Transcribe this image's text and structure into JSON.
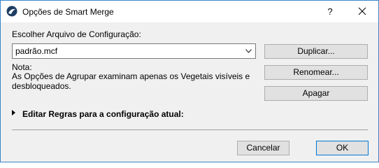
{
  "window": {
    "title": "Opções de Smart Merge",
    "help_label": "?"
  },
  "config": {
    "label": "Escolher Arquivo de Configuração:",
    "selected_file": "padrão.mcf"
  },
  "note": {
    "label": "Nota:",
    "text": "As Opções de Agrupar examinam apenas os Vegetais visíveis e desbloqueados."
  },
  "actions": {
    "duplicate": "Duplicar...",
    "rename": "Renomear...",
    "delete": "Apagar"
  },
  "rules": {
    "label": "Editar Regras para a configuração atual:"
  },
  "footer": {
    "cancel": "Cancelar",
    "ok": "OK"
  },
  "colors": {
    "window_border": "#3a85c9",
    "ok_border": "#0078d7"
  }
}
